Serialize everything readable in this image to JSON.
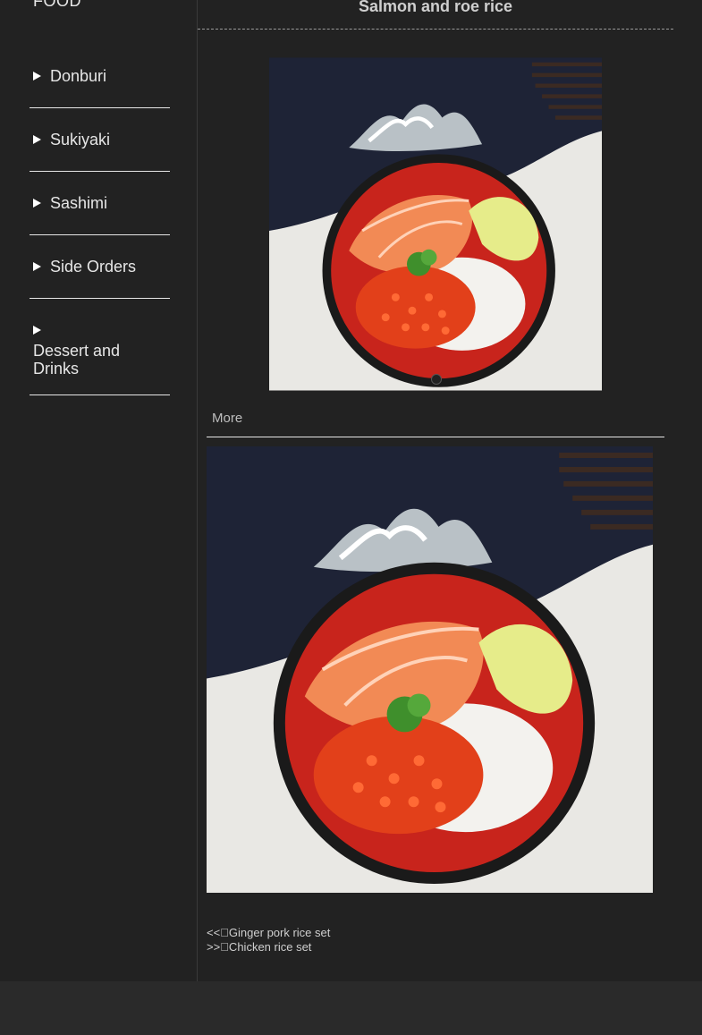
{
  "brand": "FOOD",
  "nav": [
    {
      "label": "Donburi"
    },
    {
      "label": "Sukiyaki"
    },
    {
      "label": "Sashimi"
    },
    {
      "label": "Side Orders"
    },
    {
      "label": "Dessert and Drinks"
    }
  ],
  "title": "Salmon and roe rice",
  "more_label": "More",
  "pager": {
    "prev": "<<\u0000Ginger pork rice set",
    "next": ">>\u0000Chicken rice set"
  },
  "colors": {
    "background": "#222222",
    "bowl_red": "#c8241c",
    "salmon": "#f28a55",
    "roe": "#e2401a",
    "cloth": "#1e2336"
  },
  "icons": [
    "play-triangle-icon",
    "slider-dot-icon"
  ]
}
